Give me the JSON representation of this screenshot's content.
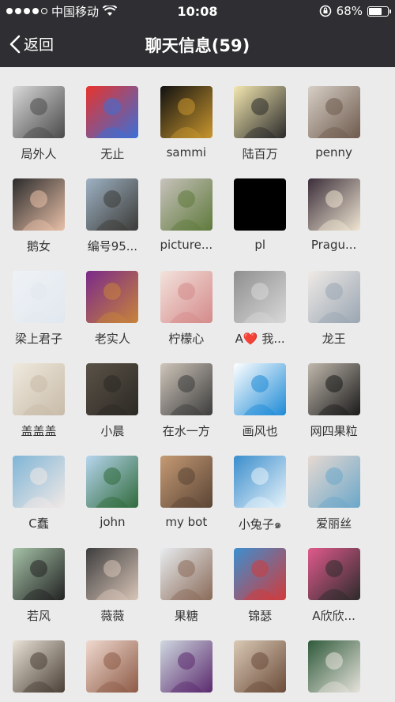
{
  "status_bar": {
    "carrier": "中国移动",
    "time": "10:08",
    "battery": "68%",
    "battery_level": 0.68,
    "signal_bars": 4
  },
  "nav": {
    "back_label": "返回",
    "title": "聊天信息(59)"
  },
  "members": [
    {
      "name": "局外人",
      "colors": [
        "#d9d9d9",
        "#4a4a4a"
      ]
    },
    {
      "name": "无止",
      "colors": [
        "#e8332c",
        "#3a6fd8"
      ]
    },
    {
      "name": "sammi",
      "colors": [
        "#111111",
        "#c9962e"
      ]
    },
    {
      "name": "陆百万",
      "colors": [
        "#f3e7b0",
        "#2a2a2a"
      ]
    },
    {
      "name": "penny",
      "colors": [
        "#d7cfc6",
        "#6e5a4d"
      ]
    },
    {
      "name": "鹅女",
      "colors": [
        "#2b2b2b",
        "#e9c0a8"
      ]
    },
    {
      "name": "编号95...",
      "colors": [
        "#9eb2c4",
        "#3b3a36"
      ]
    },
    {
      "name": "picture...",
      "colors": [
        "#c7c2bb",
        "#5f7a3c"
      ]
    },
    {
      "name": "pl",
      "colors": [
        "#000000",
        "#000000"
      ]
    },
    {
      "name": "Pragu...",
      "colors": [
        "#3b2e3a",
        "#f0e6d2"
      ]
    },
    {
      "name": "梁上君子",
      "colors": [
        "#eef2f6",
        "#e2e8ef"
      ]
    },
    {
      "name": "老实人",
      "colors": [
        "#7a2a8a",
        "#c8843a"
      ]
    },
    {
      "name": "柠檬心",
      "colors": [
        "#f3e2dc",
        "#d48a8a"
      ]
    },
    {
      "name": "A❤️ 我...",
      "colors": [
        "#8f8f8f",
        "#d8d8d8"
      ]
    },
    {
      "name": "龙王",
      "colors": [
        "#efeae6",
        "#9aa6b3"
      ]
    },
    {
      "name": "盖盖盖",
      "colors": [
        "#efe9de",
        "#c8bba8"
      ]
    },
    {
      "name": "小晨",
      "colors": [
        "#5a5247",
        "#2c2924"
      ]
    },
    {
      "name": "在水一方",
      "colors": [
        "#cfc6bb",
        "#3c3c3c"
      ]
    },
    {
      "name": "画风也",
      "colors": [
        "#ffffff",
        "#1d8ad6"
      ]
    },
    {
      "name": "网四果粒",
      "colors": [
        "#c0b8ad",
        "#1a1a1a"
      ]
    },
    {
      "name": "C蠢",
      "colors": [
        "#7fb5d6",
        "#f1e9e6"
      ]
    },
    {
      "name": "john",
      "colors": [
        "#b7d6ef",
        "#2f6a3a"
      ]
    },
    {
      "name": "my bot",
      "colors": [
        "#c69a74",
        "#5a4535"
      ]
    },
    {
      "name": "小兔子๑",
      "colors": [
        "#3a8dcc",
        "#e7f3fa"
      ]
    },
    {
      "name": "爱丽丝",
      "colors": [
        "#e7d9d1",
        "#6ba7c9"
      ]
    },
    {
      "name": "若风",
      "colors": [
        "#a6c3a8",
        "#222222"
      ]
    },
    {
      "name": "薇薇",
      "colors": [
        "#3d3d3d",
        "#d9c5b8"
      ]
    },
    {
      "name": "果糖",
      "colors": [
        "#e8ecef",
        "#8a6a58"
      ]
    },
    {
      "name": "锦瑟",
      "colors": [
        "#3c8fd0",
        "#d23a3a"
      ]
    },
    {
      "name": "A欣欣...",
      "colors": [
        "#e05a8c",
        "#2b2b2b"
      ]
    },
    {
      "name": "",
      "colors": [
        "#e9e2d6",
        "#4a3f36"
      ]
    },
    {
      "name": "",
      "colors": [
        "#f0d9cf",
        "#8d5a46"
      ]
    },
    {
      "name": "",
      "colors": [
        "#cfd8e0",
        "#5b2a6e"
      ]
    },
    {
      "name": "",
      "colors": [
        "#d9c9b4",
        "#6b4b3a"
      ]
    },
    {
      "name": "",
      "colors": [
        "#2f5a3a",
        "#e7e3dc"
      ]
    }
  ]
}
